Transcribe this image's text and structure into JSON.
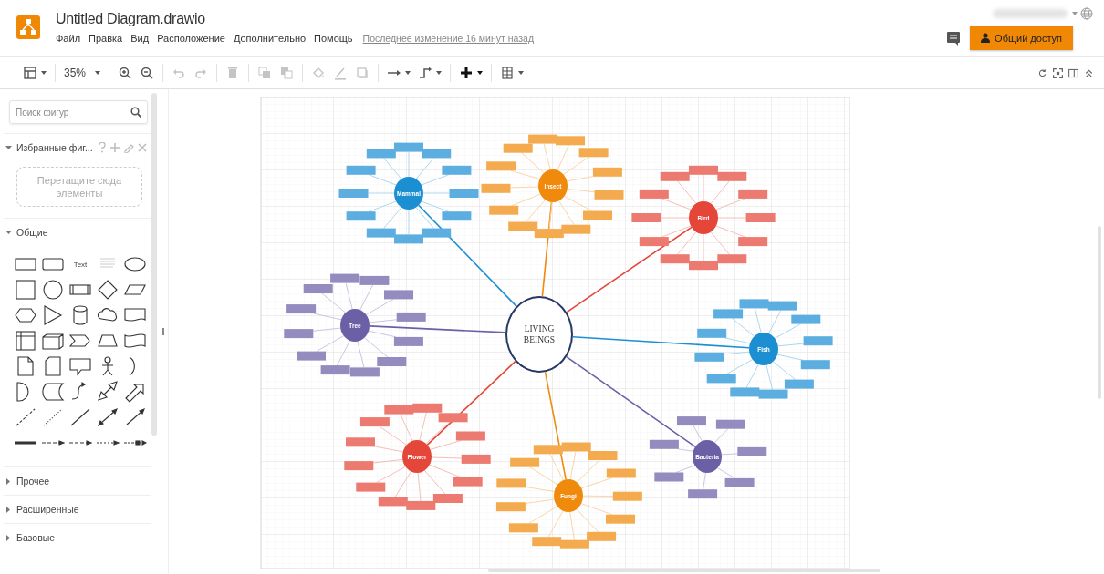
{
  "window": {
    "title": "Untitled Diagram.drawio"
  },
  "menu": [
    "Файл",
    "Правка",
    "Вид",
    "Расположение",
    "Дополнительно",
    "Помощь"
  ],
  "last_change": "Последнее изменение 16 минут назад",
  "share_button": "Общий доступ",
  "toolbar": [
    [
      {
        "kind": "format",
        "dropdown": true,
        "disabled": false
      }
    ],
    [
      {
        "kind": "zoom",
        "label": "35%",
        "dropdown": true,
        "disabled": false
      }
    ],
    [
      {
        "kind": "zoomin",
        "dropdown": false,
        "disabled": false
      },
      {
        "kind": "zoomout",
        "dropdown": false,
        "disabled": false
      }
    ],
    [
      {
        "kind": "undo",
        "dropdown": false,
        "disabled": true
      },
      {
        "kind": "redo",
        "dropdown": false,
        "disabled": true
      }
    ],
    [
      {
        "kind": "delete",
        "dropdown": false,
        "disabled": true
      }
    ],
    [
      {
        "kind": "tofront",
        "dropdown": false,
        "disabled": true
      },
      {
        "kind": "toback",
        "dropdown": false,
        "disabled": true
      }
    ],
    [
      {
        "kind": "fill",
        "dropdown": false,
        "disabled": true
      },
      {
        "kind": "line",
        "dropdown": false,
        "disabled": true
      },
      {
        "kind": "shadow",
        "dropdown": false,
        "disabled": true
      }
    ],
    [
      {
        "kind": "connection",
        "dropdown": true,
        "disabled": false
      },
      {
        "kind": "waypoints",
        "dropdown": true,
        "disabled": false
      }
    ],
    [
      {
        "kind": "insert",
        "dropdown": true,
        "disabled": false
      }
    ],
    [
      {
        "kind": "table",
        "dropdown": true,
        "disabled": false
      }
    ]
  ],
  "view_tools": [
    {
      "kind": "reset"
    },
    {
      "kind": "fullscreen"
    },
    {
      "kind": "panel"
    },
    {
      "kind": "collapse"
    }
  ],
  "sidebar": {
    "search": {
      "placeholder": "Поиск фигур"
    },
    "favorites": {
      "title": "Избранные фиг...",
      "expanded": true,
      "drop_hint": "Перетащите сюда элементы"
    },
    "general": {
      "title": "Общие",
      "expanded": true,
      "shapes": [
        {
          "kind": "rect"
        },
        {
          "kind": "rounded"
        },
        {
          "kind": "text",
          "label": "Text"
        },
        {
          "kind": "textbox"
        },
        {
          "kind": "ellipse"
        },
        {
          "kind": "square"
        },
        {
          "kind": "circle"
        },
        {
          "kind": "process"
        },
        {
          "kind": "diamond"
        },
        {
          "kind": "parallelogram"
        },
        {
          "kind": "hexagon"
        },
        {
          "kind": "triangle"
        },
        {
          "kind": "cylinder"
        },
        {
          "kind": "cloud"
        },
        {
          "kind": "document"
        },
        {
          "kind": "storage"
        },
        {
          "kind": "cube"
        },
        {
          "kind": "step"
        },
        {
          "kind": "trapezoid"
        },
        {
          "kind": "tape"
        },
        {
          "kind": "note"
        },
        {
          "kind": "card"
        },
        {
          "kind": "callout"
        },
        {
          "kind": "actor"
        },
        {
          "kind": "or"
        },
        {
          "kind": "and"
        },
        {
          "kind": "datastore"
        },
        {
          "kind": "curve"
        },
        {
          "kind": "bidiarrow"
        },
        {
          "kind": "arrow"
        },
        {
          "kind": "dashed"
        },
        {
          "kind": "dotted"
        },
        {
          "kind": "line"
        },
        {
          "kind": "biconnector"
        },
        {
          "kind": "connector"
        },
        {
          "kind": "thick"
        },
        {
          "kind": "dasharrow"
        },
        {
          "kind": "dasharrow"
        },
        {
          "kind": "dotarrow"
        },
        {
          "kind": "boxarrow"
        }
      ]
    },
    "sections": [
      {
        "title": "Прочее",
        "expanded": false
      },
      {
        "title": "Расширенные",
        "expanded": false
      },
      {
        "title": "Базовые",
        "expanded": false
      }
    ]
  },
  "diagram": {
    "center": {
      "label": "LIVING BEINGS"
    },
    "hubs": [
      {
        "label": "Mammal",
        "color": "#1b8fd2"
      },
      {
        "label": "Insect",
        "color": "#f08a0c"
      },
      {
        "label": "Bird",
        "color": "#e5463a"
      },
      {
        "label": "Tree",
        "color": "#6b5fa6"
      },
      {
        "label": "Fish",
        "color": "#1b8fd2"
      },
      {
        "label": "Flower",
        "color": "#e5463a"
      },
      {
        "label": "Fungi",
        "color": "#f08a0c"
      },
      {
        "label": "Bacteria",
        "color": "#6b5fa6"
      }
    ]
  }
}
